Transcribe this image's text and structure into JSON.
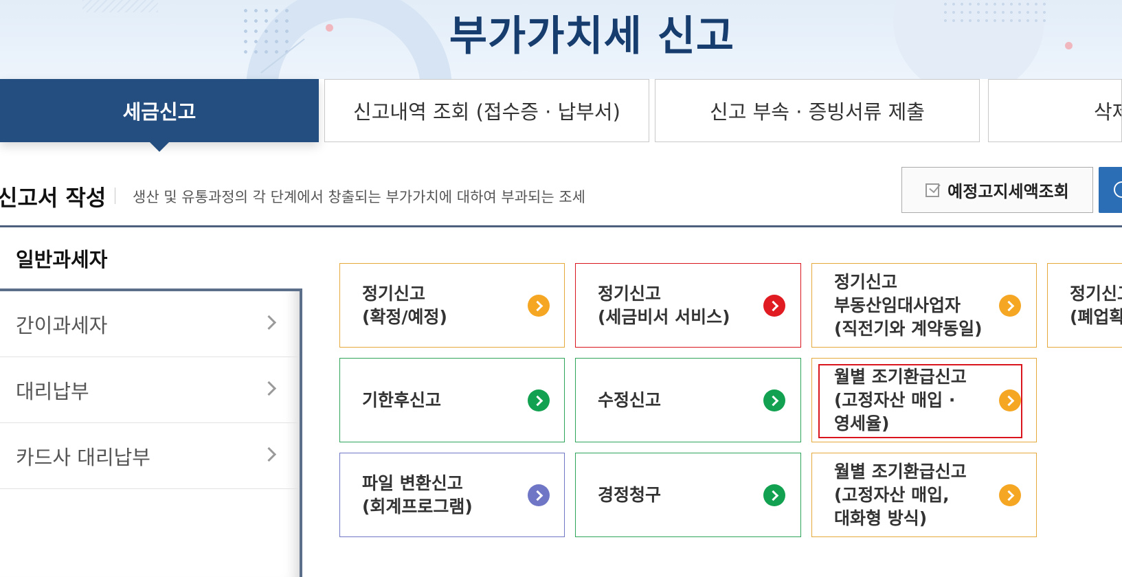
{
  "page": {
    "title": "부가가치세 신고"
  },
  "tabs": [
    {
      "label": "세금신고",
      "active": true
    },
    {
      "label": "신고내역 조회 (접수증 · 납부서)",
      "active": false
    },
    {
      "label": "신고 부속 · 증빙서류 제출",
      "active": false
    },
    {
      "label": "삭제",
      "active": false
    }
  ],
  "section": {
    "title": "신고서 작성",
    "description": "생산 및 유통과정의 각 단계에서 창출되는 부가가치에 대하여 부과되는 조세",
    "lookup_button": "예정고지세액조회"
  },
  "side_menu": {
    "current": "일반과세자",
    "items": [
      {
        "label": "간이과세자"
      },
      {
        "label": "대리납부"
      },
      {
        "label": "카드사 대리납부"
      }
    ]
  },
  "cards": [
    {
      "label": "정기신고\n(확정/예정)",
      "border_color": "#e5a93a",
      "arrow_color": "#f5a623"
    },
    {
      "label": "정기신고\n(세금비서 서비스)",
      "border_color": "#d9141d",
      "arrow_color": "#e11b22"
    },
    {
      "label": "정기신고\n부동산임대사업자\n(직전기와 계약동일)",
      "border_color": "#e5a93a",
      "arrow_color": "#f5a623"
    },
    {
      "label": "정기신고\n(폐업확정)",
      "border_color": "#e5a93a",
      "arrow_color": "#f5a623"
    },
    {
      "label": "기한후신고",
      "border_color": "#2ea35a",
      "arrow_color": "#12a150"
    },
    {
      "label": "수정신고",
      "border_color": "#2ea35a",
      "arrow_color": "#12a150"
    },
    {
      "label": "월별 조기환급신고\n(고정자산 매입 ·\n영세율)",
      "border_color": "#e5a93a",
      "arrow_color": "#f5a623"
    },
    {
      "label": "파일 변환신고\n(회계프로그램)",
      "border_color": "#6f76c5",
      "arrow_color": "#6f76c5"
    },
    {
      "label": "경정청구",
      "border_color": "#2ea35a",
      "arrow_color": "#12a150"
    },
    {
      "label": "월별 조기환급신고\n(고정자산 매입,\n대화형 방식)",
      "border_color": "#e5a93a",
      "arrow_color": "#f5a623"
    }
  ]
}
